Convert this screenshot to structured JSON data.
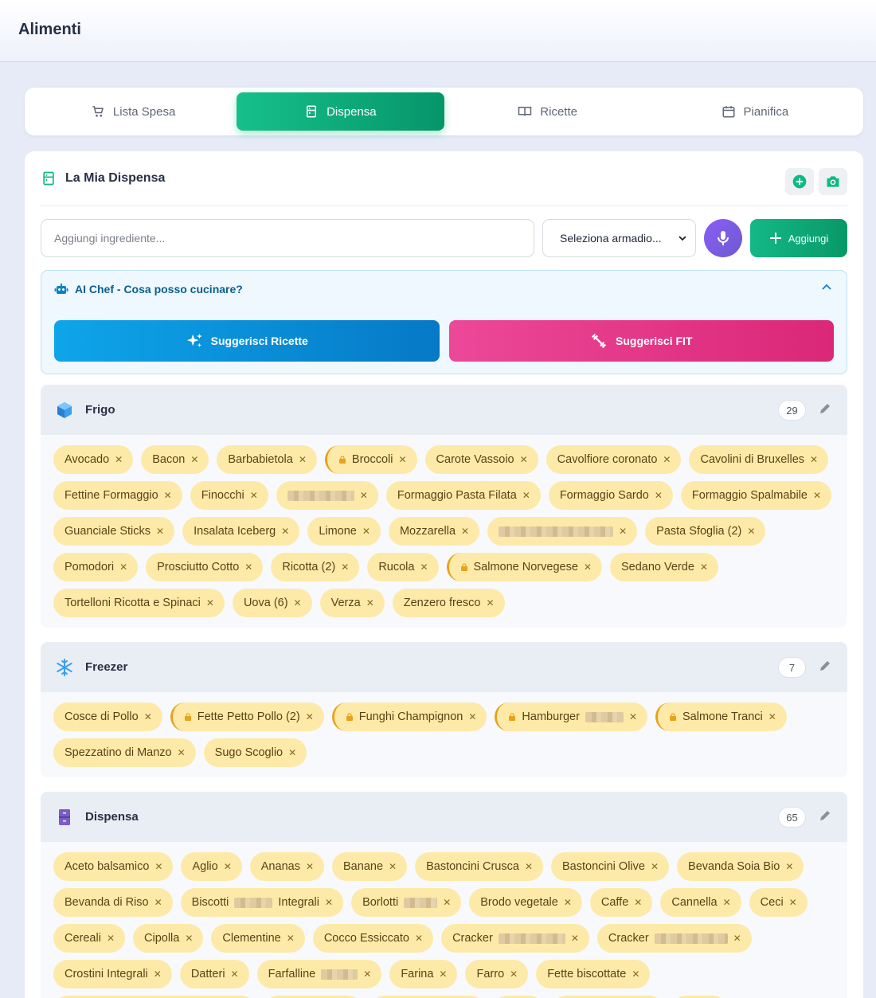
{
  "header": {
    "title": "Alimenti"
  },
  "tabs": [
    {
      "label": "Lista Spesa",
      "icon": "cart-icon"
    },
    {
      "label": "Dispensa",
      "icon": "pantry-icon",
      "active": true
    },
    {
      "label": "Ricette",
      "icon": "book-icon"
    },
    {
      "label": "Pianifica",
      "icon": "calendar-icon"
    }
  ],
  "pantry": {
    "title": "La Mia Dispensa",
    "input_placeholder": "Aggiungi ingrediente...",
    "select_value": "Seleziona armadio...",
    "add_label": "Aggiungi"
  },
  "ai": {
    "title": "AI Chef - Cosa posso cucinare?",
    "suggest_recipes": "Suggerisci Ricette",
    "suggest_fit": "Suggerisci FIT"
  },
  "sections": {
    "frigo": {
      "name": "Frigo",
      "count": "29"
    },
    "freezer": {
      "name": "Freezer",
      "count": "7"
    },
    "dispensa": {
      "name": "Dispensa",
      "count": "65"
    }
  },
  "frigo_items": [
    "Avocado",
    "Bacon",
    "Barbabietola",
    "Broccoli",
    "Carote Vassoio",
    "Cavolfiore coronato",
    "Cavolini di Bruxelles",
    "Fettine Formaggio",
    "Finocchi",
    "",
    "Formaggio Pasta Filata",
    "Formaggio Sardo",
    "Formaggio Spalmabile",
    "Guanciale Sticks",
    "Insalata Iceberg",
    "Limone",
    "Mozzarella",
    "",
    "Pasta Sfoglia (2)",
    "Pomodori",
    "Prosciutto Cotto",
    "Ricotta (2)",
    "Rucola",
    "Salmone Norvegese",
    "Sedano Verde",
    "Tortelloni Ricotta e Spinaci",
    "Uova (6)",
    "Verza",
    "Zenzero fresco"
  ],
  "freezer_items": [
    "Cosce di Pollo",
    "Fette Petto Pollo (2)",
    "Funghi Champignon",
    "Hamburger",
    "Salmone Tranci",
    "Spezzatino di Manzo",
    "Sugo Scoglio"
  ],
  "dispensa_items": [
    "Aceto balsamico",
    "Aglio",
    "Ananas",
    "Banane",
    "Bastoncini Crusca",
    "Bastoncini Olive",
    "Bevanda Soia Bio",
    "Bevanda di Riso",
    "Biscotti",
    "Integrali",
    "Borlotti",
    "Brodo vegetale",
    "Caffe",
    "Cannella",
    "Ceci",
    "Cereali",
    "Cipolla",
    "Clementine",
    "Cocco Essiccato",
    "Cracker",
    "Cracker",
    "Crostini Integrali",
    "Datteri",
    "Farfalline",
    "Farina",
    "Farro",
    "Fette biscottate"
  ],
  "colors": {
    "accent": "#10b981",
    "chip": "#fdeaa8",
    "chip_text": "#5b4216",
    "lock": "#e7a21e"
  }
}
